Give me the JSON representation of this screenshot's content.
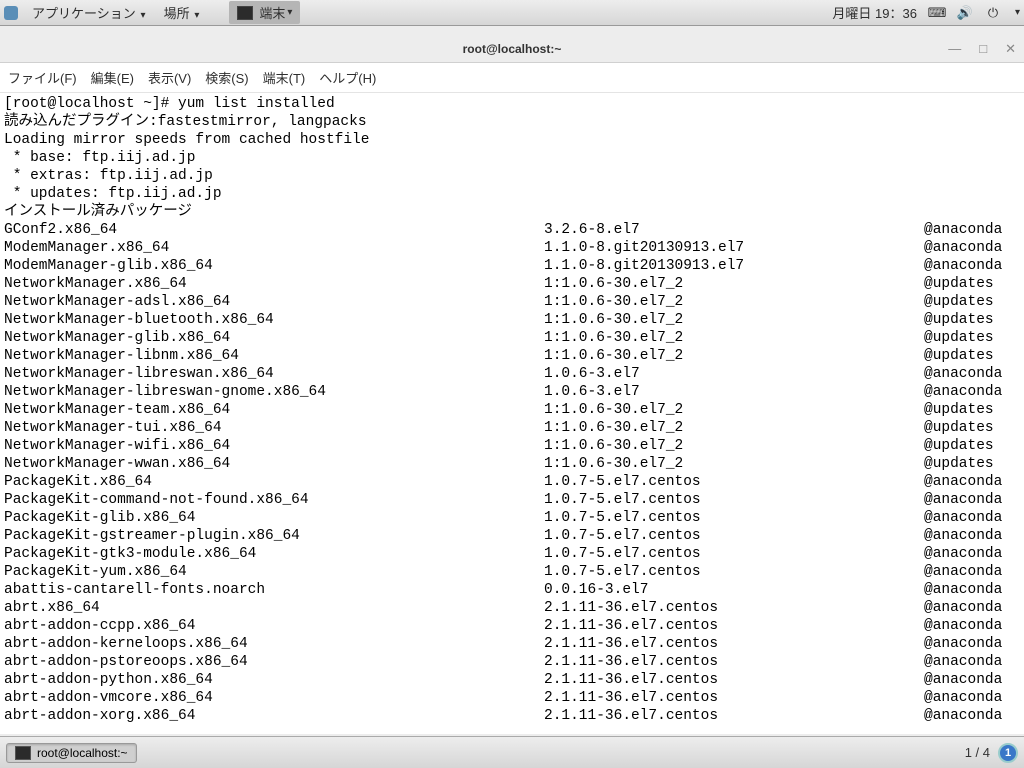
{
  "top_panel": {
    "applications": "アプリケーション",
    "places": "場所",
    "active_task": "端末",
    "date": "月曜日 19：36"
  },
  "window": {
    "title": "root@localhost:~",
    "menubar": [
      "ファイル(F)",
      "編集(E)",
      "表示(V)",
      "検索(S)",
      "端末(T)",
      "ヘルプ(H)"
    ]
  },
  "terminal": {
    "prompt": "[root@localhost ~]# ",
    "command": "yum list installed",
    "lines": [
      "読み込んだプラグイン:fastestmirror, langpacks",
      "Loading mirror speeds from cached hostfile",
      " * base: ftp.iij.ad.jp",
      " * extras: ftp.iij.ad.jp",
      " * updates: ftp.iij.ad.jp",
      "インストール済みパッケージ"
    ],
    "packages": [
      {
        "name": "GConf2.x86_64",
        "ver": "3.2.6-8.el7",
        "repo": "@anaconda"
      },
      {
        "name": "ModemManager.x86_64",
        "ver": "1.1.0-8.git20130913.el7",
        "repo": "@anaconda"
      },
      {
        "name": "ModemManager-glib.x86_64",
        "ver": "1.1.0-8.git20130913.el7",
        "repo": "@anaconda"
      },
      {
        "name": "NetworkManager.x86_64",
        "ver": "1:1.0.6-30.el7_2",
        "repo": "@updates"
      },
      {
        "name": "NetworkManager-adsl.x86_64",
        "ver": "1:1.0.6-30.el7_2",
        "repo": "@updates"
      },
      {
        "name": "NetworkManager-bluetooth.x86_64",
        "ver": "1:1.0.6-30.el7_2",
        "repo": "@updates"
      },
      {
        "name": "NetworkManager-glib.x86_64",
        "ver": "1:1.0.6-30.el7_2",
        "repo": "@updates"
      },
      {
        "name": "NetworkManager-libnm.x86_64",
        "ver": "1:1.0.6-30.el7_2",
        "repo": "@updates"
      },
      {
        "name": "NetworkManager-libreswan.x86_64",
        "ver": "1.0.6-3.el7",
        "repo": "@anaconda"
      },
      {
        "name": "NetworkManager-libreswan-gnome.x86_64",
        "ver": "1.0.6-3.el7",
        "repo": "@anaconda"
      },
      {
        "name": "NetworkManager-team.x86_64",
        "ver": "1:1.0.6-30.el7_2",
        "repo": "@updates"
      },
      {
        "name": "NetworkManager-tui.x86_64",
        "ver": "1:1.0.6-30.el7_2",
        "repo": "@updates"
      },
      {
        "name": "NetworkManager-wifi.x86_64",
        "ver": "1:1.0.6-30.el7_2",
        "repo": "@updates"
      },
      {
        "name": "NetworkManager-wwan.x86_64",
        "ver": "1:1.0.6-30.el7_2",
        "repo": "@updates"
      },
      {
        "name": "PackageKit.x86_64",
        "ver": "1.0.7-5.el7.centos",
        "repo": "@anaconda"
      },
      {
        "name": "PackageKit-command-not-found.x86_64",
        "ver": "1.0.7-5.el7.centos",
        "repo": "@anaconda"
      },
      {
        "name": "PackageKit-glib.x86_64",
        "ver": "1.0.7-5.el7.centos",
        "repo": "@anaconda"
      },
      {
        "name": "PackageKit-gstreamer-plugin.x86_64",
        "ver": "1.0.7-5.el7.centos",
        "repo": "@anaconda"
      },
      {
        "name": "PackageKit-gtk3-module.x86_64",
        "ver": "1.0.7-5.el7.centos",
        "repo": "@anaconda"
      },
      {
        "name": "PackageKit-yum.x86_64",
        "ver": "1.0.7-5.el7.centos",
        "repo": "@anaconda"
      },
      {
        "name": "abattis-cantarell-fonts.noarch",
        "ver": "0.0.16-3.el7",
        "repo": "@anaconda"
      },
      {
        "name": "abrt.x86_64",
        "ver": "2.1.11-36.el7.centos",
        "repo": "@anaconda"
      },
      {
        "name": "abrt-addon-ccpp.x86_64",
        "ver": "2.1.11-36.el7.centos",
        "repo": "@anaconda"
      },
      {
        "name": "abrt-addon-kerneloops.x86_64",
        "ver": "2.1.11-36.el7.centos",
        "repo": "@anaconda"
      },
      {
        "name": "abrt-addon-pstoreoops.x86_64",
        "ver": "2.1.11-36.el7.centos",
        "repo": "@anaconda"
      },
      {
        "name": "abrt-addon-python.x86_64",
        "ver": "2.1.11-36.el7.centos",
        "repo": "@anaconda"
      },
      {
        "name": "abrt-addon-vmcore.x86_64",
        "ver": "2.1.11-36.el7.centos",
        "repo": "@anaconda"
      },
      {
        "name": "abrt-addon-xorg.x86_64",
        "ver": "2.1.11-36.el7.centos",
        "repo": "@anaconda"
      }
    ]
  },
  "bottom_panel": {
    "task": "root@localhost:~",
    "workspace_label": "1 / 4",
    "workspace_current": "1"
  }
}
